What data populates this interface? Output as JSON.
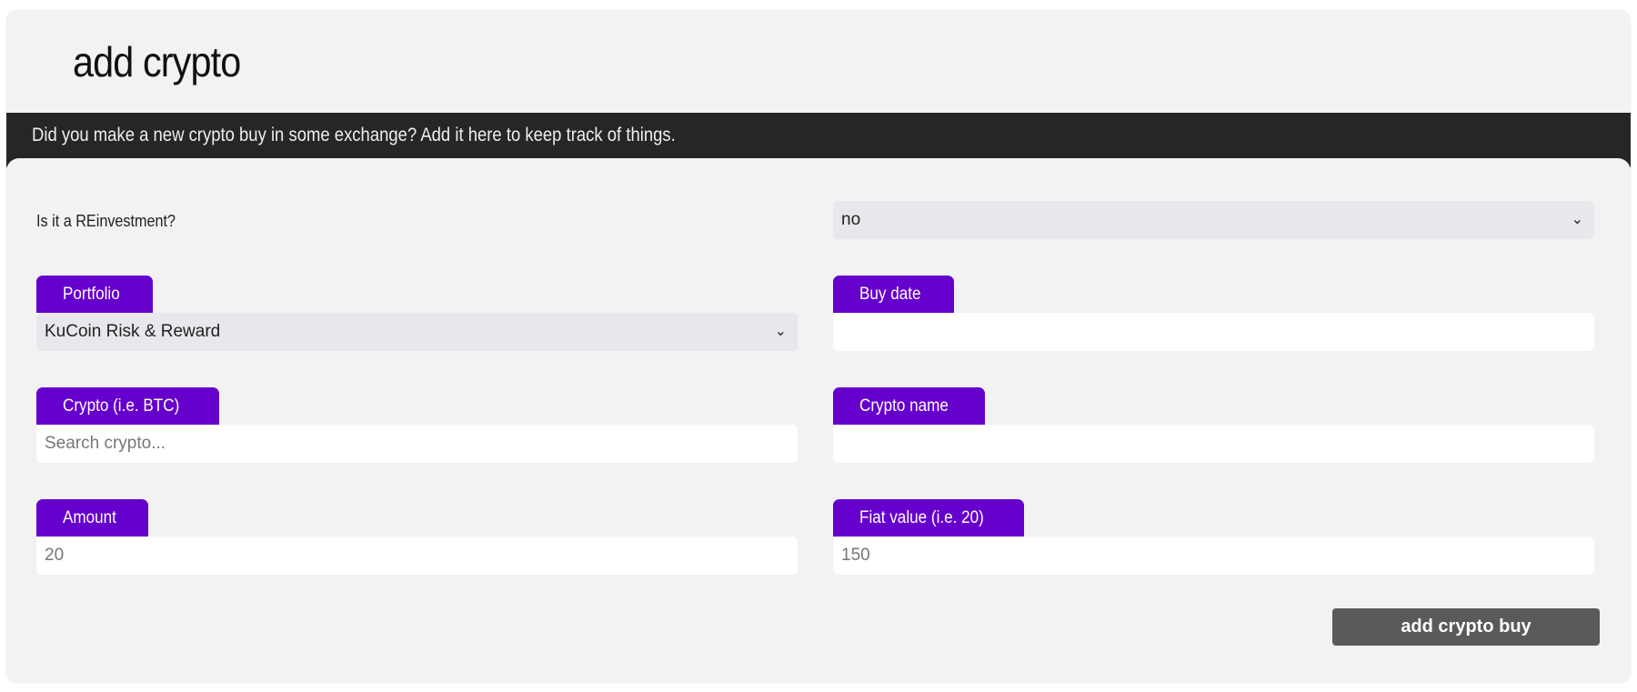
{
  "header": {
    "title": "add crypto",
    "subtitle": "Did you make a new crypto buy in some exchange? Add it here to keep track of things."
  },
  "form": {
    "reinvestment": {
      "label": "Is it a REinvestment?",
      "value": "no"
    },
    "portfolio": {
      "label": "Portfolio",
      "value": "KuCoin Risk & Reward"
    },
    "buy_date": {
      "label": "Buy date",
      "value": ""
    },
    "crypto": {
      "label": "Crypto (i.e. BTC)",
      "placeholder": "Search crypto..."
    },
    "crypto_name": {
      "label": "Crypto name",
      "value": ""
    },
    "amount": {
      "label": "Amount",
      "value": "20"
    },
    "fiat_value": {
      "label": "Fiat value (i.e. 20)",
      "value": "150"
    },
    "submit_label": "add crypto buy"
  },
  "colors": {
    "accent": "#6600cc",
    "header_bar": "#262626",
    "button": "#5a5a5a"
  }
}
